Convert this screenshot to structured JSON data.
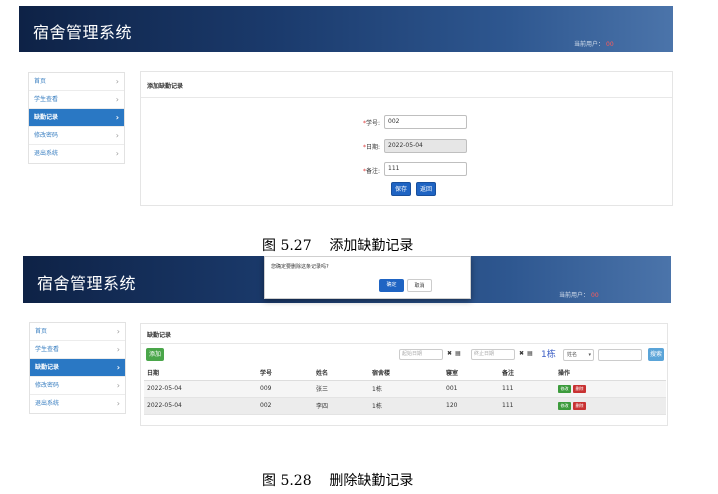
{
  "figure1": {
    "caption": "图 5.27    添加缺勤记录",
    "header": {
      "title": "宿舍管理系统",
      "current_user_label": "当前用户：",
      "current_user_name": "00"
    },
    "sidebar": {
      "items": [
        {
          "label": "首页",
          "active": false
        },
        {
          "label": "学生查看",
          "active": false
        },
        {
          "label": "缺勤记录",
          "active": true
        },
        {
          "label": "修改密码",
          "active": false
        },
        {
          "label": "退出系统",
          "active": false
        }
      ],
      "chevron": "›"
    },
    "panel_title": "添加缺勤记录",
    "form": {
      "required_mark": "*",
      "fields": [
        {
          "label": "学号:",
          "value": "002",
          "readonly": false
        },
        {
          "label": "日期:",
          "value": "2022-05-04",
          "readonly": true
        },
        {
          "label": "备注:",
          "value": "111",
          "readonly": false
        }
      ],
      "save_label": "保存",
      "back_label": "返回"
    }
  },
  "figure2": {
    "caption": "图 5.28    删除缺勤记录",
    "header": {
      "title": "宿舍管理系统",
      "current_user_label": "当前用户：",
      "current_user_name": "00"
    },
    "sidebar": {
      "items": [
        {
          "label": "首页",
          "active": false
        },
        {
          "label": "学生查看",
          "active": false
        },
        {
          "label": "缺勤记录",
          "active": true
        },
        {
          "label": "修改密码",
          "active": false
        },
        {
          "label": "退出系统",
          "active": false
        }
      ],
      "chevron": "›"
    },
    "dialog": {
      "message": "您确定要删除这条记录吗?",
      "ok_label": "确定",
      "cancel_label": "取消"
    },
    "panel_title": "缺勤记录",
    "toolbar": {
      "add_label": "添加",
      "start_date_placeholder": "起始日期",
      "end_date_placeholder": "终止日期",
      "clear_icon": "✖",
      "calendar_icon": "▦",
      "building": "1栋",
      "select_value": "姓名",
      "select_caret": "▾",
      "search_label": "搜索"
    },
    "table": {
      "headers": [
        "日期",
        "学号",
        "姓名",
        "宿舍楼",
        "寝室",
        "备注",
        "操作"
      ],
      "rows": [
        [
          "2022-05-04",
          "009",
          "张三",
          "1栋",
          "001",
          "111"
        ],
        [
          "2022-05-04",
          "002",
          "李四",
          "1栋",
          "120",
          "111"
        ]
      ],
      "edit_label": "修改",
      "delete_label": "删除"
    }
  },
  "colors": {
    "banner_dark": "#0e2246",
    "banner_light": "#4b74aa",
    "active_nav": "#2a78c4",
    "primary_button": "#1f64c3",
    "add_button": "#4aa64a",
    "delete_button": "#c83232"
  }
}
